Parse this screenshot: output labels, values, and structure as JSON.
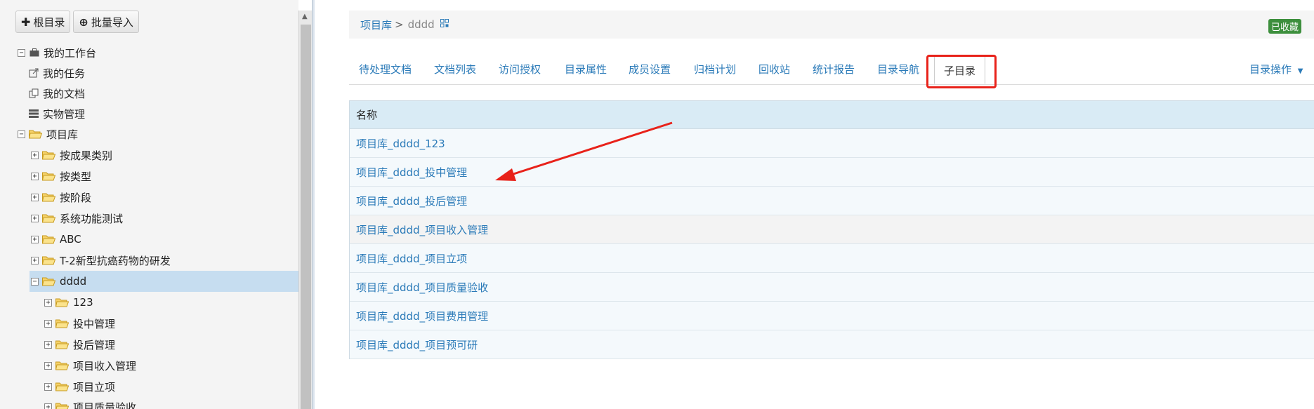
{
  "toolbar": {
    "root_label": "根目录",
    "import_label": "批量导入"
  },
  "tree": {
    "workbench": "我的工作台",
    "tasks": "我的任务",
    "docs": "我的文档",
    "physical": "实物管理",
    "project_lib": "项目库",
    "by_result": "按成果类别",
    "by_type": "按类型",
    "by_stage": "按阶段",
    "sys_test": "系统功能测试",
    "abc": "ABC",
    "t2": "T-2新型抗癌药物的研发",
    "dddd": "dddd",
    "c123": "123",
    "mid": "投中管理",
    "post": "投后管理",
    "income": "项目收入管理",
    "setup": "项目立项",
    "quality": "项目质量验收"
  },
  "breadcrumb": {
    "root": "项目库",
    "sep": ">",
    "current": "dddd"
  },
  "fav_badge": "已收藏",
  "tabs": [
    "待处理文档",
    "文档列表",
    "访问授权",
    "目录属性",
    "成员设置",
    "归档计划",
    "回收站",
    "统计报告",
    "目录导航",
    "子目录"
  ],
  "dir_ops": "目录操作",
  "table": {
    "header": "名称",
    "rows": [
      "项目库_dddd_123",
      "项目库_dddd_投中管理",
      "项目库_dddd_投后管理",
      "项目库_dddd_项目收入管理",
      "项目库_dddd_项目立项",
      "项目库_dddd_项目质量验收",
      "项目库_dddd_项目费用管理",
      "项目库_dddd_项目预可研"
    ]
  },
  "colors": {
    "link": "#2a7ab8",
    "highlight": "#e8221a",
    "badge": "#3d8f3d",
    "selected": "#c6ddf0"
  }
}
